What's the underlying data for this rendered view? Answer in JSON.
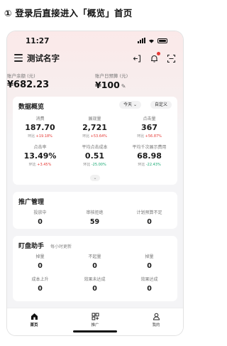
{
  "caption": "① 登录后直接进入「概览」首页",
  "status_bar": {
    "time": "11:27"
  },
  "header": {
    "account_name": "测试名字"
  },
  "balance": {
    "label": "账户余额 (元)",
    "value": "¥682.23"
  },
  "budget": {
    "label": "账户日预算 (元)",
    "value": "¥100"
  },
  "overview": {
    "title": "数据概览",
    "range": "今天",
    "custom": "自定义",
    "metrics": [
      {
        "label": "消费",
        "value": "187.70",
        "compare_prefix": "环比",
        "compare": "+19.18%"
      },
      {
        "label": "展现量",
        "value": "2,721",
        "compare_prefix": "环比",
        "compare": "+53.64%"
      },
      {
        "label": "点击量",
        "value": "367",
        "compare_prefix": "环比",
        "compare": "+56.87%"
      },
      {
        "label": "点击率",
        "value": "13.49%",
        "compare_prefix": "环比",
        "compare": "+3.45%"
      },
      {
        "label": "平均点击成本",
        "value": "0.51",
        "compare_prefix": "环比",
        "compare": "-25.00%"
      },
      {
        "label": "平均千次展示费用",
        "value": "68.98",
        "compare_prefix": "环比",
        "compare": "-22.43%"
      }
    ]
  },
  "promotion": {
    "title": "推广管理",
    "items": [
      {
        "label": "投放中",
        "value": "0"
      },
      {
        "label": "审核拒绝",
        "value": "59"
      },
      {
        "label": "计划预算不足",
        "value": "0"
      }
    ]
  },
  "monitor": {
    "title": "盯盘助手",
    "subtitle": "每小时更新",
    "items": [
      {
        "label": "掉量",
        "value": "0"
      },
      {
        "label": "不起量",
        "value": "0"
      },
      {
        "label": "掉量",
        "value": "0"
      },
      {
        "label": "成本上升",
        "value": "0"
      },
      {
        "label": "效果未达成",
        "value": "0"
      },
      {
        "label": "效果达成",
        "value": "0"
      }
    ]
  },
  "tabbar": {
    "items": [
      {
        "label": "首页",
        "icon": "home-icon"
      },
      {
        "label": "推广",
        "icon": "grid-icon"
      },
      {
        "label": "我的",
        "icon": "profile-icon"
      }
    ]
  },
  "colors": {
    "up": "#e53935",
    "down": "#19a974"
  }
}
